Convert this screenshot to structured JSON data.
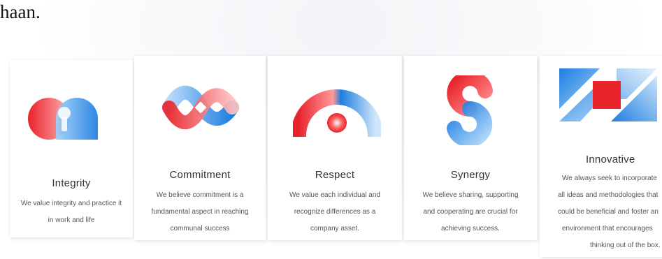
{
  "header_fragment": "haan.",
  "values": [
    {
      "title": "Integrity",
      "desc_lines": [
        "We value integrity and practice it",
        "in work and life"
      ]
    },
    {
      "title": "Commitment",
      "desc_lines": [
        "We believe commitment is a",
        "fundamental aspect in reaching",
        "communal success"
      ]
    },
    {
      "title": "Respect",
      "desc_lines": [
        "We value each individual and",
        "recognize differences as a",
        "company asset."
      ]
    },
    {
      "title": "Synergy",
      "desc_lines": [
        "We believe sharing, supporting",
        "and cooperating are crucial for",
        "achieving success."
      ]
    },
    {
      "title": "Innovative",
      "desc_lines": [
        "We always seek to incorporate",
        "all ideas and methodologies that",
        "could be beneficial and foster an",
        "environment that encourages",
        "thinking out of the box."
      ]
    }
  ],
  "icons": [
    "keyhole-icon",
    "wave-icon",
    "arch-icon",
    "s-curve-icon",
    "square-icon"
  ],
  "colors": {
    "red": "#e8232b",
    "blue": "#1e7ee0",
    "light_blue": "#8ec6f5",
    "pink": "#ff8a8a"
  }
}
